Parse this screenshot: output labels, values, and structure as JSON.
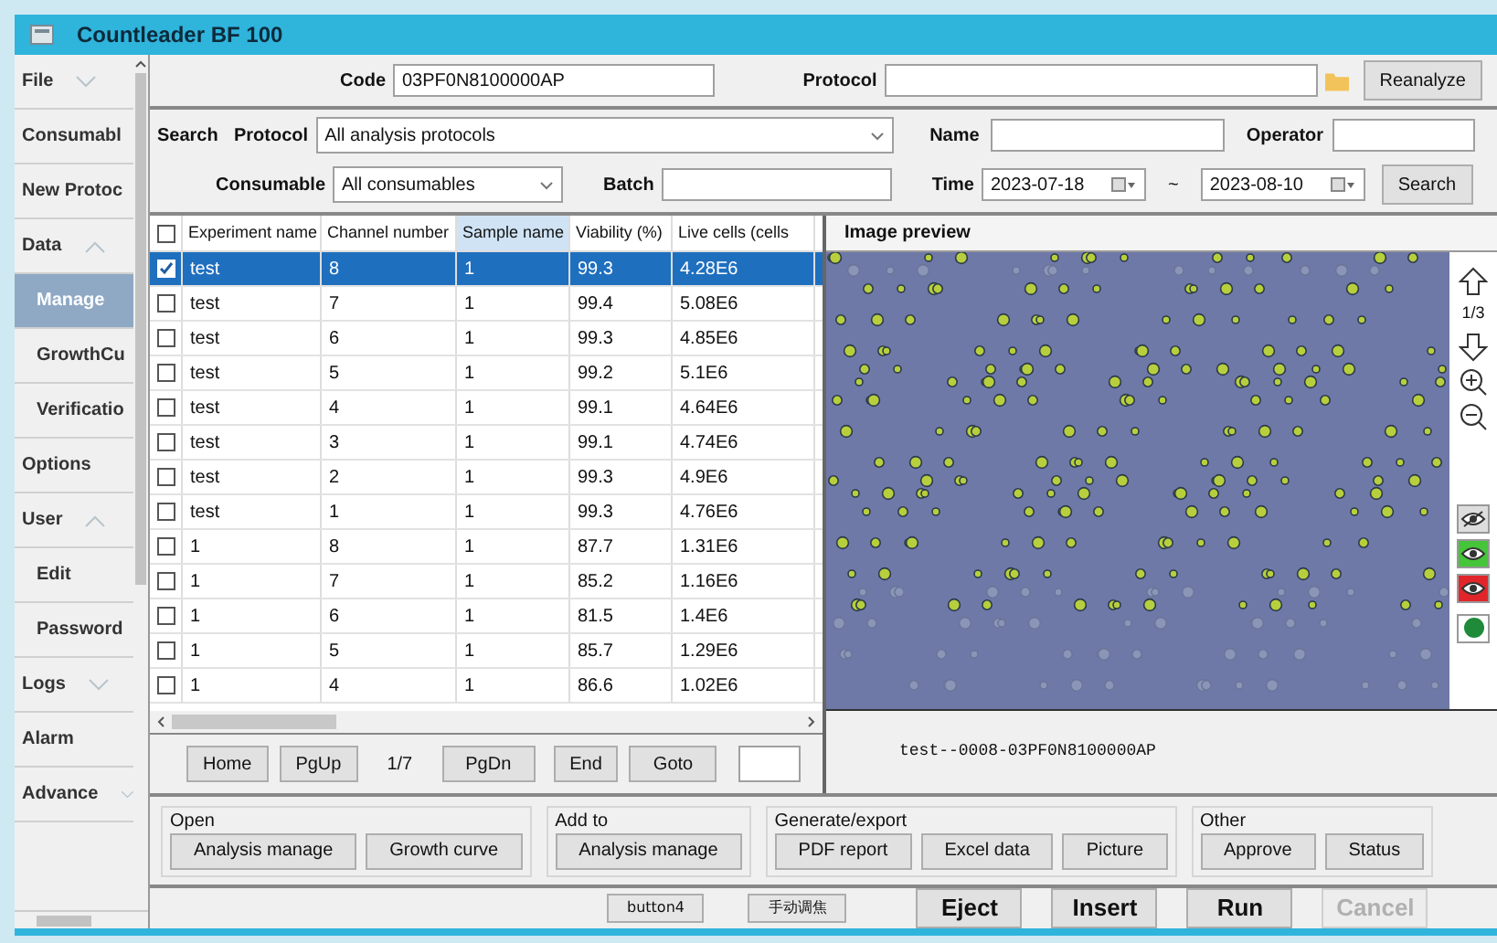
{
  "window": {
    "title": "Countleader BF 100"
  },
  "sidebar": {
    "items": [
      {
        "label": "File",
        "kind": "group",
        "expanded": false,
        "selected": false
      },
      {
        "label": "Consumabl",
        "kind": "item",
        "selected": false
      },
      {
        "label": "New Protoc",
        "kind": "item",
        "selected": false
      },
      {
        "label": "Data",
        "kind": "group",
        "expanded": true,
        "selected": false,
        "children": [
          {
            "label": "Manage",
            "selected": true
          },
          {
            "label": "GrowthCu",
            "selected": false
          },
          {
            "label": "Verificatio",
            "selected": false
          }
        ]
      },
      {
        "label": "Options",
        "kind": "item",
        "selected": false
      },
      {
        "label": "User",
        "kind": "group",
        "expanded": true,
        "selected": false,
        "children": [
          {
            "label": "Edit",
            "selected": false
          },
          {
            "label": "Password",
            "selected": false
          }
        ]
      },
      {
        "label": "Logs",
        "kind": "group",
        "expanded": false,
        "selected": false
      },
      {
        "label": "Alarm",
        "kind": "item",
        "selected": false
      },
      {
        "label": "Advance",
        "kind": "group",
        "expanded": false,
        "selected": false
      }
    ]
  },
  "code_bar": {
    "code_label": "Code",
    "code_value": "03PF0N8100000AP",
    "protocol_label": "Protocol",
    "reanalyze_button": "Reanalyze"
  },
  "search": {
    "title": "Search",
    "protocol_label": "Protocol",
    "protocol_value": "All analysis protocols",
    "name_label": "Name",
    "operator_label": "Operator",
    "consumable_label": "Consumable",
    "consumable_value": "All consumables",
    "batch_label": "Batch",
    "time_label": "Time",
    "time_from": "2023-07-18",
    "separator": "~",
    "time_to": "2023-08-10",
    "search_button": "Search"
  },
  "table": {
    "header_checked": false,
    "columns": [
      {
        "label": "Experiment name",
        "selected": false
      },
      {
        "label": "Channel number",
        "selected": false
      },
      {
        "label": "Sample name",
        "selected": true
      },
      {
        "label": "Viability (%)",
        "selected": false
      },
      {
        "label": "Live cells (cells",
        "selected": false
      }
    ],
    "rows": [
      {
        "checked": true,
        "selected": true,
        "cells": [
          "test",
          "8",
          "1",
          "99.3",
          "4.28E6"
        ]
      },
      {
        "checked": false,
        "selected": false,
        "cells": [
          "test",
          "7",
          "1",
          "99.4",
          "5.08E6"
        ]
      },
      {
        "checked": false,
        "selected": false,
        "cells": [
          "test",
          "6",
          "1",
          "99.3",
          "4.85E6"
        ]
      },
      {
        "checked": false,
        "selected": false,
        "cells": [
          "test",
          "5",
          "1",
          "99.2",
          "5.1E6"
        ]
      },
      {
        "checked": false,
        "selected": false,
        "cells": [
          "test",
          "4",
          "1",
          "99.1",
          "4.64E6"
        ]
      },
      {
        "checked": false,
        "selected": false,
        "cells": [
          "test",
          "3",
          "1",
          "99.1",
          "4.74E6"
        ]
      },
      {
        "checked": false,
        "selected": false,
        "cells": [
          "test",
          "2",
          "1",
          "99.3",
          "4.9E6"
        ]
      },
      {
        "checked": false,
        "selected": false,
        "cells": [
          "test",
          "1",
          "1",
          "99.3",
          "4.76E6"
        ]
      },
      {
        "checked": false,
        "selected": false,
        "cells": [
          "1",
          "8",
          "1",
          "87.7",
          "1.31E6"
        ]
      },
      {
        "checked": false,
        "selected": false,
        "cells": [
          "1",
          "7",
          "1",
          "85.2",
          "1.16E6"
        ]
      },
      {
        "checked": false,
        "selected": false,
        "cells": [
          "1",
          "6",
          "1",
          "81.5",
          "1.4E6"
        ]
      },
      {
        "checked": false,
        "selected": false,
        "cells": [
          "1",
          "5",
          "1",
          "85.7",
          "1.29E6"
        ]
      },
      {
        "checked": false,
        "selected": false,
        "cells": [
          "1",
          "4",
          "1",
          "86.6",
          "1.02E6"
        ]
      }
    ]
  },
  "pager": {
    "first": "Home",
    "prev": "PgUp",
    "page": "1/7",
    "next": "PgDn",
    "last": "End",
    "goto": "Goto"
  },
  "preview": {
    "title": "Image preview",
    "page": "1/3",
    "caption": "test--0008-03PF0N8100000AP"
  },
  "groups": [
    {
      "title": "Open",
      "buttons": [
        "Analysis manage",
        "Growth curve"
      ]
    },
    {
      "title": "Add to",
      "buttons": [
        "Analysis manage"
      ]
    },
    {
      "title": "Generate/export",
      "buttons": [
        "PDF report",
        "Excel data",
        "Picture"
      ]
    },
    {
      "title": "Other",
      "buttons": [
        "Approve",
        "Status"
      ]
    }
  ],
  "footer": {
    "small_buttons": [
      "button4",
      "手动调焦"
    ],
    "buttons": [
      {
        "label": "Eject",
        "disabled": false
      },
      {
        "label": "Insert",
        "disabled": false
      },
      {
        "label": "Run",
        "disabled": false
      },
      {
        "label": "Cancel",
        "disabled": true
      }
    ]
  }
}
